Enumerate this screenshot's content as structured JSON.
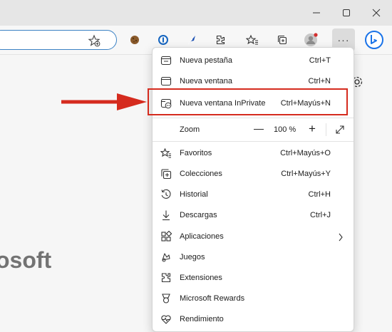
{
  "titlebar": {
    "minimize_icon": "minimize-icon",
    "maximize_icon": "maximize-icon",
    "close_icon": "close-icon"
  },
  "toolbar": {
    "more_label": "···",
    "icons": [
      "favorite-add-icon",
      "cookie-extension-icon",
      "password-manager-icon",
      "feather-extension-icon",
      "extensions-icon",
      "favorites-icon",
      "collections-icon",
      "profile-avatar",
      "bing-icon"
    ]
  },
  "page": {
    "brand_text": "osoft"
  },
  "menu": {
    "items": [
      {
        "label": "Nueva pestaña",
        "shortcut": "Ctrl+T",
        "icon": "new-tab-icon"
      },
      {
        "label": "Nueva ventana",
        "shortcut": "Ctrl+N",
        "icon": "new-window-icon"
      },
      {
        "label": "Nueva ventana InPrivate",
        "shortcut": "Ctrl+Mayús+N",
        "icon": "inprivate-window-icon"
      },
      {
        "label": "Favoritos",
        "shortcut": "Ctrl+Mayús+O",
        "icon": "favorites-icon"
      },
      {
        "label": "Colecciones",
        "shortcut": "Ctrl+Mayús+Y",
        "icon": "collections-icon"
      },
      {
        "label": "Historial",
        "shortcut": "Ctrl+H",
        "icon": "history-icon"
      },
      {
        "label": "Descargas",
        "shortcut": "Ctrl+J",
        "icon": "download-icon"
      },
      {
        "label": "Aplicaciones",
        "shortcut": "",
        "icon": "apps-icon"
      },
      {
        "label": "Juegos",
        "shortcut": "",
        "icon": "games-icon"
      },
      {
        "label": "Extensiones",
        "shortcut": "",
        "icon": "extensions-icon"
      },
      {
        "label": "Microsoft Rewards",
        "shortcut": "",
        "icon": "rewards-icon"
      },
      {
        "label": "Rendimiento",
        "shortcut": "",
        "icon": "performance-icon"
      }
    ],
    "zoom": {
      "label": "Zoom",
      "value": "100 %",
      "minus": "—",
      "plus": "+"
    }
  },
  "colors": {
    "highlight": "#d52b1e",
    "accent": "#0078d4"
  }
}
